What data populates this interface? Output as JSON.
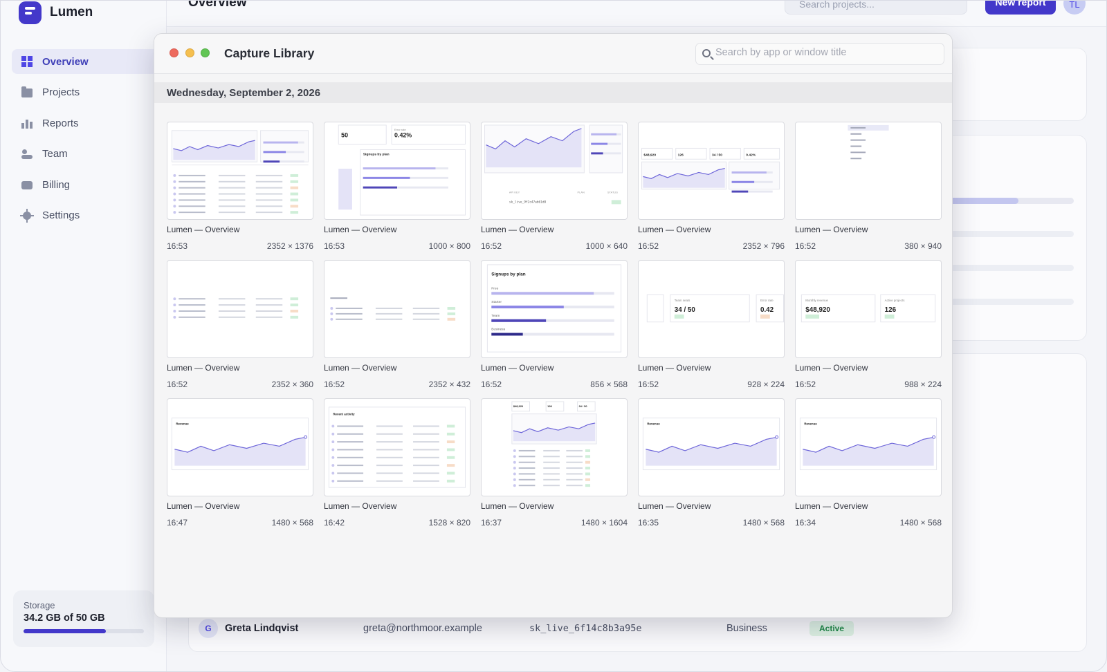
{
  "app": {
    "name": "Lumen",
    "page_title": "Overview",
    "search_placeholder": "Search projects...",
    "new_report_label": "New report",
    "avatar_initials": "TL"
  },
  "sidebar": {
    "items": [
      {
        "label": "Overview",
        "icon": "grid-icon",
        "active": true
      },
      {
        "label": "Projects",
        "icon": "folder-icon"
      },
      {
        "label": "Reports",
        "icon": "bar-chart-icon"
      },
      {
        "label": "Team",
        "icon": "people-icon"
      },
      {
        "label": "Billing",
        "icon": "card-icon"
      },
      {
        "label": "Settings",
        "icon": "gear-icon"
      }
    ],
    "storage": {
      "label": "Storage",
      "value": "34.2 GB of 50 GB",
      "fraction": 0.684
    }
  },
  "background_row": {
    "initial": "G",
    "name": "Greta Lindqvist",
    "email": "greta@northmoor.example",
    "key": "sk_live_6f14c8b3a95e",
    "plan": "Business",
    "status": "Active"
  },
  "modal": {
    "title": "Capture Library",
    "search_placeholder": "Search by app or window title",
    "date_heading": "Wednesday, September 2, 2026",
    "captures": [
      {
        "title": "Lumen — Overview",
        "time": "16:53",
        "size": "2352 × 1376",
        "kind": "dashboard"
      },
      {
        "title": "Lumen — Overview",
        "time": "16:53",
        "size": "1000 × 800",
        "kind": "signups-stats"
      },
      {
        "title": "Lumen — Overview",
        "time": "16:52",
        "size": "1000 × 640",
        "kind": "chart-keys"
      },
      {
        "title": "Lumen — Overview",
        "time": "16:52",
        "size": "2352 × 796",
        "kind": "stats-chart"
      },
      {
        "title": "Lumen — Overview",
        "time": "16:52",
        "size": "380 × 940",
        "kind": "sidebar"
      },
      {
        "title": "Lumen — Overview",
        "time": "16:52",
        "size": "2352 × 360",
        "kind": "table-small"
      },
      {
        "title": "Lumen — Overview",
        "time": "16:52",
        "size": "2352 × 432",
        "kind": "table-header"
      },
      {
        "title": "Lumen — Overview",
        "time": "16:52",
        "size": "856 × 568",
        "kind": "signups"
      },
      {
        "title": "Lumen — Overview",
        "time": "16:52",
        "size": "928 × 224",
        "kind": "seats"
      },
      {
        "title": "Lumen — Overview",
        "time": "16:52",
        "size": "988 × 224",
        "kind": "revenue-cards"
      },
      {
        "title": "Lumen — Overview",
        "time": "16:47",
        "size": "1480 × 568",
        "kind": "revenue-chart"
      },
      {
        "title": "Lumen — Overview",
        "time": "16:42",
        "size": "1528 × 820",
        "kind": "activity"
      },
      {
        "title": "Lumen — Overview",
        "time": "16:37",
        "size": "1480 × 1604",
        "kind": "tall"
      },
      {
        "title": "Lumen — Overview",
        "time": "16:35",
        "size": "1480 × 568",
        "kind": "revenue-chart"
      },
      {
        "title": "Lumen — Overview",
        "time": "16:34",
        "size": "1480 × 568",
        "kind": "revenue-chart"
      }
    ],
    "thumb_text": {
      "stat_50": "50",
      "error_rate": "Error rate",
      "rate_value": "0.42%",
      "signups_by_plan": "Signups by plan",
      "free": "Free",
      "starter": "Starter",
      "team": "Team",
      "business": "Business",
      "api_key": "API KEY",
      "plan_head": "PLAN",
      "status_head": "STATUS",
      "key_sample": "sk_live_9f2c47ab61d8",
      "team_seats": "Team seats",
      "seats_value": "34 / 50",
      "error_value": "0.42",
      "monthly_revenue": "Monthly revenue",
      "revenue_value": "$48,920",
      "active_projects": "Active projects",
      "projects_value": "126",
      "revenue": "Revenue",
      "recent_activity": "Recent activity"
    }
  },
  "colors": {
    "accent": "#4338ca",
    "chart_fill": "#e4e3f7",
    "chart_line": "#6d65d9",
    "status_green": "#1f8a47"
  }
}
